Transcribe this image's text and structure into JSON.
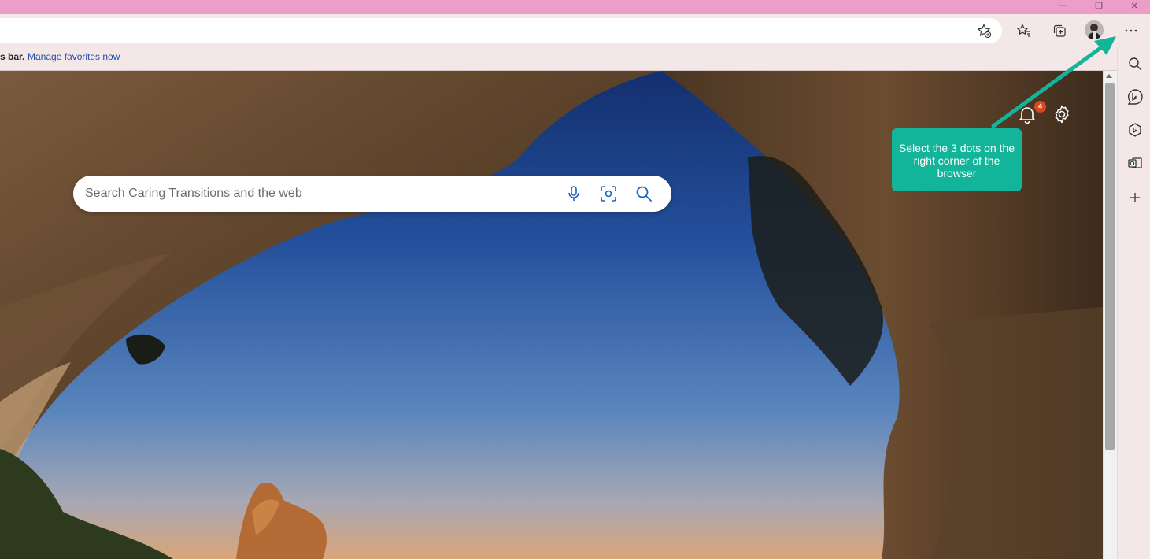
{
  "window": {
    "minimize_glyph": "—",
    "restore_glyph": "❐",
    "close_glyph": "✕"
  },
  "favorites_bar": {
    "message": "s bar.",
    "manage_link": "Manage favorites now"
  },
  "search": {
    "placeholder": "Search Caring Transitions and the web"
  },
  "notifications": {
    "count": "4"
  },
  "callout": {
    "text": "Select the 3 dots on the right corner of the browser"
  },
  "colors": {
    "titlebar": "#ec9ec9",
    "callout": "#12b59a",
    "badge": "#d9481f",
    "link": "#1f4fa8"
  },
  "icons": [
    "favorite-add-icon",
    "favorites-icon",
    "collections-icon",
    "profile-avatar",
    "more-options-icon",
    "sidebar-search-icon",
    "bing-chat-icon",
    "copilot-icon",
    "outlook-icon",
    "add-icon",
    "microphone-icon",
    "visual-search-icon",
    "search-icon",
    "bell-icon",
    "gear-icon"
  ]
}
